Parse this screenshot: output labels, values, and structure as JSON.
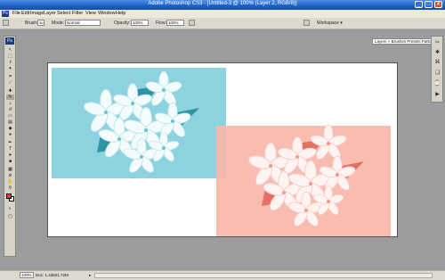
{
  "window": {
    "title": "Adobe Photoshop CS3 - [Untitled-3 @ 100% (Layer 2, RGB/8)]",
    "minimize": "_",
    "maximize": "□",
    "close": "✕"
  },
  "menubar": {
    "app_icon": "Ps",
    "items": [
      "File",
      "Edit",
      "Image",
      "Layer",
      "Select",
      "Filter",
      "View",
      "Window",
      "Help"
    ]
  },
  "options": {
    "brush_label": "Brush:",
    "brush_size": "30",
    "mode_label": "Mode:",
    "mode_value": "Normal",
    "opacity_label": "Opacity:",
    "opacity_value": "100%",
    "flow_label": "Flow:",
    "flow_value": "100%",
    "workspace_label": "Workspace ▾",
    "palette_well": "Layers × Brushes Presets Paths"
  },
  "toolbox": {
    "header": "Ps",
    "foreground_color": "#d94040",
    "background_color": "#ffffff"
  },
  "status": {
    "zoom": "100%",
    "doc": "Doc: 1.43M/1.72M",
    "arrow": "▸"
  },
  "colors": {
    "canvas": "#ffffff",
    "cyan_layer": "#8dd3df",
    "pink_layer": "#f8b8ad"
  },
  "icons": {
    "toolbox": [
      "move-icon",
      "marquee-icon",
      "lasso-icon",
      "magic-wand-icon",
      "crop-icon",
      "slice-icon",
      "healing-icon",
      "brush-icon",
      "stamp-icon",
      "history-brush-icon",
      "eraser-icon",
      "gradient-icon",
      "blur-icon",
      "dodge-icon",
      "pen-icon",
      "type-icon",
      "path-select-icon",
      "shape-icon",
      "notes-icon",
      "eyedropper-icon",
      "hand-icon",
      "zoom-icon"
    ],
    "dock": [
      "tools-dock-icon",
      "brushes-dock-icon",
      "clone-dock-icon",
      "layers-dock-icon",
      "history-dock-icon",
      "actions-dock-icon"
    ]
  }
}
